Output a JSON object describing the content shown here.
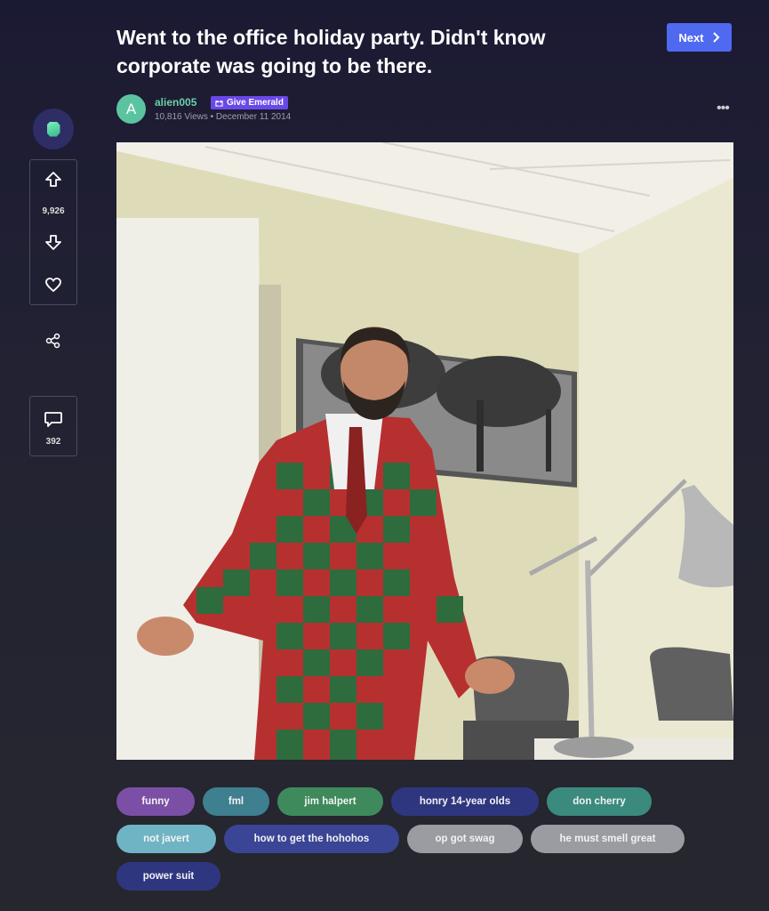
{
  "post": {
    "title": "Went to the office holiday party. Didn't know corporate was going to be there.",
    "next_label": "Next",
    "author": "alien005",
    "avatar_letter": "A",
    "give_emerald_label": "Give Emerald",
    "views": "10,816 Views",
    "date": "December 11 2014",
    "more_label": "•••"
  },
  "rail": {
    "score": "9,926",
    "comment_count": "392"
  },
  "tags": [
    {
      "label": "funny",
      "color": "#7b4fa6"
    },
    {
      "label": "fml",
      "color": "#3e7f90"
    },
    {
      "label": "jim halpert",
      "color": "#3e8a5c"
    },
    {
      "label": "honry 14-year olds",
      "color": "#2f3680"
    },
    {
      "label": "don cherry",
      "color": "#3b8a7e"
    },
    {
      "label": "not javert",
      "color": "#6fb4c4"
    },
    {
      "label": "how to get the hohohos",
      "color": "#3a4595"
    },
    {
      "label": "op got swag",
      "color": "#9a9ca2"
    },
    {
      "label": "he must smell great",
      "color": "#9a9ca2"
    },
    {
      "label": "power suit",
      "color": "#2f3680"
    }
  ]
}
